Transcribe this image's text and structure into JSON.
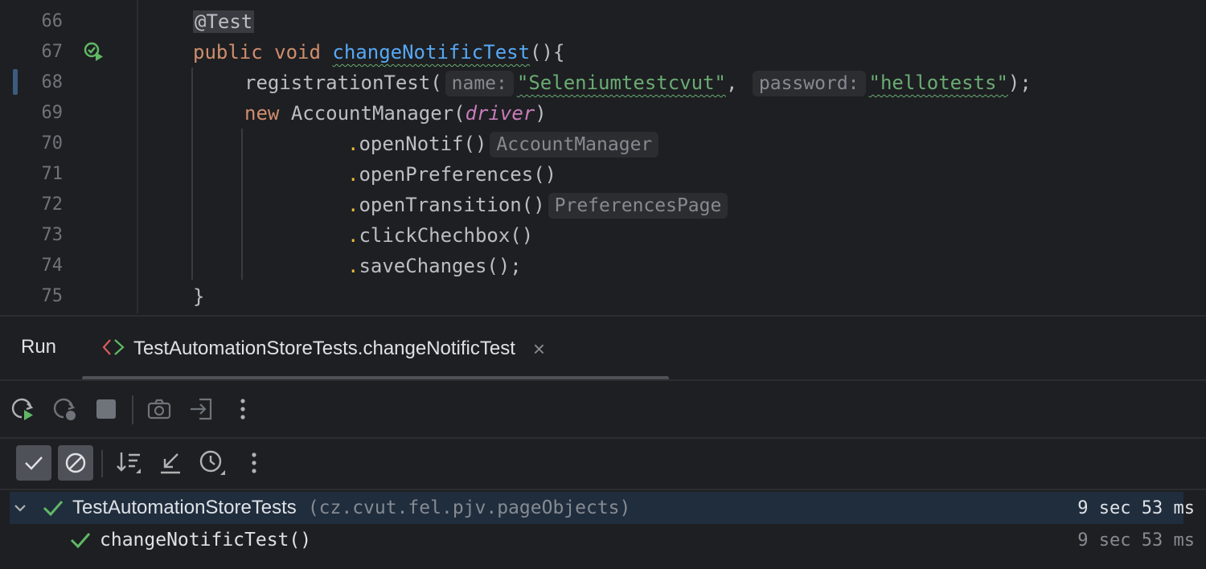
{
  "editor": {
    "line_numbers": [
      "66",
      "67",
      "68",
      "69",
      "70",
      "71",
      "72",
      "73",
      "74",
      "75"
    ],
    "code": {
      "l66_annotation": "@Test",
      "l67_public": "public",
      "l67_void": "void",
      "l67_method": "changeNotificTest",
      "l67_tail": "(){",
      "l68_call": "registrationTest(",
      "l68_hint_name": "name:",
      "l68_arg1": "\"Seleniumtestcvut\"",
      "l68_comma": ",",
      "l68_hint_password": "password:",
      "l68_arg2": "\"hellotests\"",
      "l68_tail": ");",
      "l69_new": "new",
      "l69_class": "AccountManager(",
      "l69_field": "driver",
      "l69_tail": ")",
      "l70_call": "openNotif()",
      "l70_hint": "AccountManager",
      "l71_call": "openPreferences()",
      "l72_call": "openTransition()",
      "l72_hint": "PreferencesPage",
      "l73_call": "clickChechbox()",
      "l74_call": "saveChanges();",
      "l75_brace": "}"
    },
    "dot": "."
  },
  "run_panel": {
    "title": "Run",
    "tab_label": "TestAutomationStoreTests.changeNotificTest",
    "tab_close": "×"
  },
  "toolbar": {
    "icons": [
      "rerun-icon",
      "rerun-failed-icon",
      "stop-icon",
      "screenshot-icon",
      "export-icon",
      "more-icon"
    ]
  },
  "test_toolbar": {
    "icons": [
      "show-passed-icon",
      "show-ignored-icon",
      "sort-icon",
      "collapse-icon",
      "history-icon",
      "more-icon"
    ]
  },
  "results": [
    {
      "name": "TestAutomationStoreTests",
      "package": "(cz.cvut.fel.pjv.pageObjects)",
      "time": "9 sec 53 ms",
      "status": "passed"
    },
    {
      "name": "changeNotificTest()",
      "time": "9 sec 53 ms",
      "status": "passed"
    }
  ],
  "colors": {
    "background": "#1e1f22",
    "keyword": "#cf8e6d",
    "method": "#56a8f5",
    "string": "#6aab73",
    "field": "#c77dbb",
    "pass": "#5fb865"
  }
}
